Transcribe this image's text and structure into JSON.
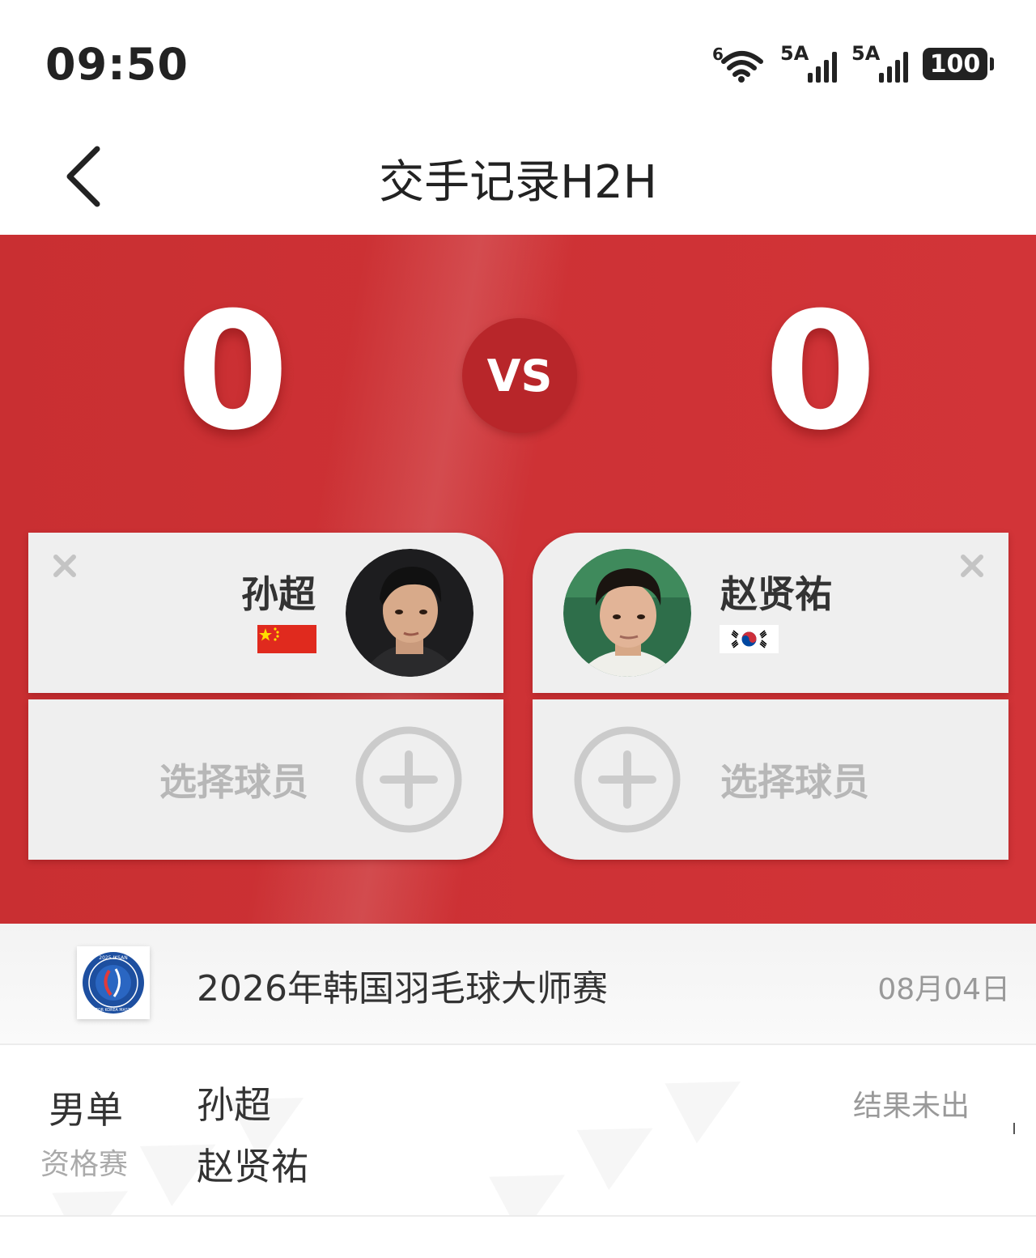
{
  "status_bar": {
    "time": "09:50",
    "wifi_badge": "6",
    "signal1_label": "5A",
    "signal2_label": "5A",
    "battery": "100"
  },
  "header": {
    "title": "交手记录H2H",
    "back_icon": "chevron-left-icon"
  },
  "h2h": {
    "score_left": "0",
    "score_right": "0",
    "vs_label": "VS",
    "player1": {
      "name": "孙超",
      "flag": "china-flag-icon"
    },
    "player2": {
      "name": "赵贤祐",
      "flag": "korea-flag-icon"
    },
    "partner_left_label": "选择球员",
    "partner_right_label": "选择球员"
  },
  "tournament": {
    "name": "2026年韩国羽毛球大师赛",
    "date": "08月04日",
    "logo_text_top": "2025 IKSAN",
    "logo_text_bottom": "VICTOR KOREA MASTERS"
  },
  "match": {
    "event": "男单",
    "round": "资格赛",
    "player_a": "孙超",
    "player_b": "赵贤祐",
    "result": "结果未出"
  },
  "colors": {
    "hero_red": "#cf3236",
    "vs_circle": "#b8262a",
    "card_bg": "#efefef"
  }
}
